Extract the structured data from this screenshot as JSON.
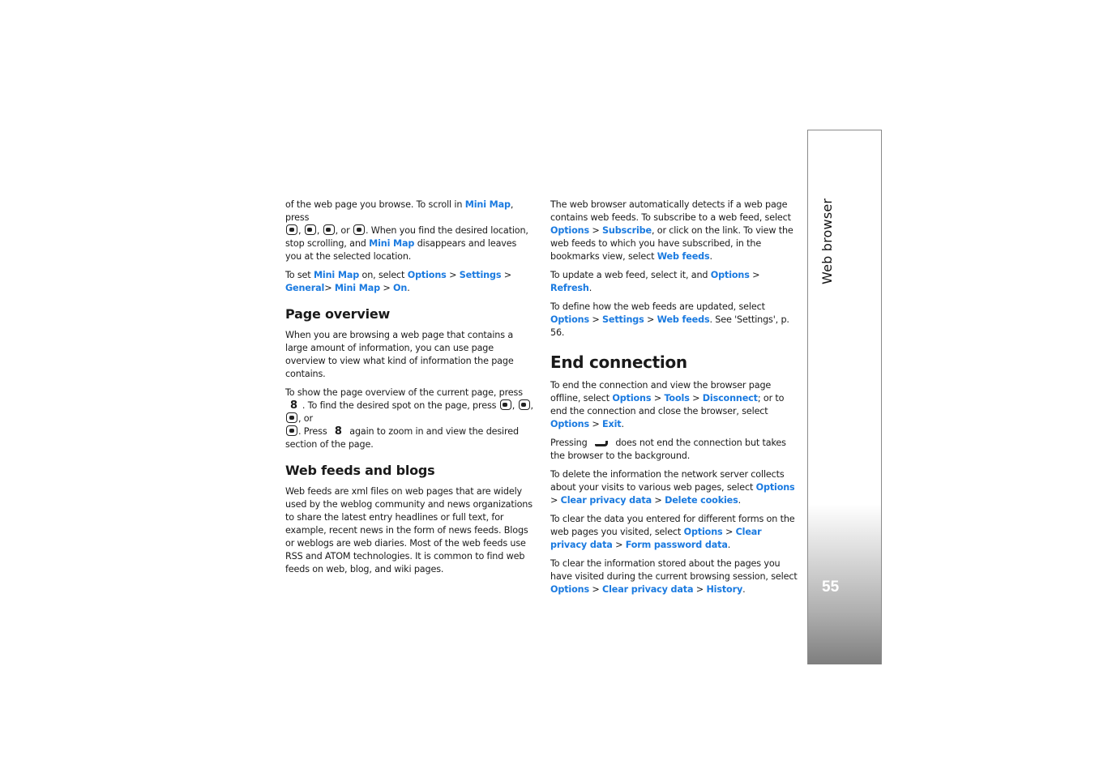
{
  "side_tab": {
    "chapter_title": "Web browser",
    "page_number": "55",
    "gradient_dark": "#7e7e7e"
  },
  "link_color": "#1a7ae0",
  "left_column": {
    "p1": {
      "t1": "of the web page you browse. To scroll in ",
      "l1": "Mini Map",
      "t2": ", press ",
      "t3": ", ",
      "t4": ", ",
      "t5": ", or ",
      "t6": ". When you find the desired location, stop scrolling, and ",
      "l2": "Mini Map",
      "t7": " disappears and leaves you at the selected location."
    },
    "p2": {
      "t1": "To set ",
      "l1": "Mini Map",
      "t2": " on, select ",
      "l2": "Options",
      "t3": " > ",
      "l3": "Settings",
      "t4": " > ",
      "l4": "General",
      "t5": "> ",
      "l5": "Mini Map",
      "t6": " > ",
      "l6": "On",
      "t7": "."
    },
    "heading_page_overview": "Page overview",
    "p3": "When you are browsing a web page that contains a large amount of information, you can use page overview to view what kind of information the page contains.",
    "p4": {
      "t1": "To show the page overview of the current page, press ",
      "key8": "8",
      "t2": ". To find the desired spot on the page, press ",
      "t3": ", ",
      "t4": ", ",
      "t5": ", or ",
      "t6": ". Press ",
      "t7": " again to zoom in and view the desired section of the page."
    },
    "heading_web_feeds": "Web feeds and blogs",
    "p5": "Web feeds are xml files on web pages that are widely used by the weblog community and news organizations to share the latest entry headlines or full text, for example, recent news in the form of news feeds. Blogs or weblogs are web diaries. Most of the web feeds use RSS and ATOM technologies. It is common to find web feeds on web, blog, and wiki pages."
  },
  "right_column": {
    "p1": {
      "t1": "The web browser automatically detects if a web page contains web feeds. To subscribe to a web feed, select ",
      "l1": "Options",
      "t2": " > ",
      "l2": "Subscribe",
      "t3": ", or click on the link. To view the web feeds to which you have subscribed, in the bookmarks view, select ",
      "l3": "Web feeds",
      "t4": "."
    },
    "p2": {
      "t1": "To update a web feed, select it, and ",
      "l1": "Options",
      "t2": " > ",
      "l2": "Refresh",
      "t3": "."
    },
    "p3": {
      "t1": "To define how the web feeds are updated, select ",
      "l1": "Options",
      "t2": " > ",
      "l2": "Settings",
      "t3": " > ",
      "l3": "Web feeds",
      "t4": ". See 'Settings', p. 56."
    },
    "heading_end_connection": "End connection",
    "p4": {
      "t1": "To end the connection and view the browser page offline, select ",
      "l1": "Options",
      "t2": " > ",
      "l2": "Tools",
      "t3": " > ",
      "l3": "Disconnect",
      "t4": "; or to end the connection and close the browser, select ",
      "l4": "Options",
      "t5": " > ",
      "l5": "Exit",
      "t6": "."
    },
    "p5": {
      "t1": "Pressing ",
      "t2": " does not end the connection but takes the browser to the background."
    },
    "p6": {
      "t1": "To delete the information the network server collects about your visits to various web pages, select ",
      "l1": "Options",
      "t2": " > ",
      "l2": "Clear privacy data",
      "t3": " > ",
      "l3": "Delete cookies",
      "t4": "."
    },
    "p7": {
      "t1": "To clear the data you entered for different forms on the web pages you visited, select ",
      "l1": "Options",
      "t2": " > ",
      "l2": "Clear privacy data",
      "t3": " > ",
      "l3": "Form password data",
      "t4": "."
    },
    "p8": {
      "t1": "To clear the information stored about the pages you have visited during the current browsing session, select ",
      "l1": "Options",
      "t2": " > ",
      "l2": "Clear privacy data",
      "t3": " > ",
      "l3": "History",
      "t4": "."
    }
  },
  "icons": {
    "scroll_left": "scroll-left-key",
    "scroll_right": "scroll-right-key",
    "scroll_up": "scroll-up-key",
    "scroll_down": "scroll-down-key",
    "end_key": "end-call-key"
  }
}
